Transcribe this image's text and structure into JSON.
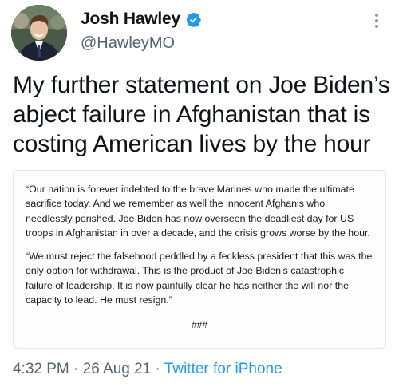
{
  "author": {
    "display_name": "Josh Hawley",
    "handle": "@HawleyMO",
    "verified": true,
    "verified_color": "#1d9bf0"
  },
  "tweet": {
    "text": "My further statement on Joe Biden’s abject failure in Afghanistan that is costing American lives by the hour",
    "statement_paragraphs": [
      "“Our nation is forever indebted to the brave Marines who made the ultimate sacrifice today. And we remember as well the innocent Afghanis who needlessly perished. Joe Biden has now overseen the deadliest day for US troops in Afghanistan in over a decade, and the crisis grows worse by the hour.",
      "“We must reject the falsehood peddled by a feckless president that this was the only option for withdrawal. This is the product of Joe Biden’s catastrophic failure of leadership. It is now painfully clear he has neither the will nor the capacity to lead. He must resign.”"
    ],
    "statement_footer": "###"
  },
  "meta": {
    "time": "4:32 PM",
    "separator1": " · ",
    "date": "26 Aug 21",
    "separator2": " · ",
    "source": "Twitter for iPhone"
  },
  "icons": {
    "verified": "verified-badge-icon",
    "more": "more-options-icon"
  }
}
